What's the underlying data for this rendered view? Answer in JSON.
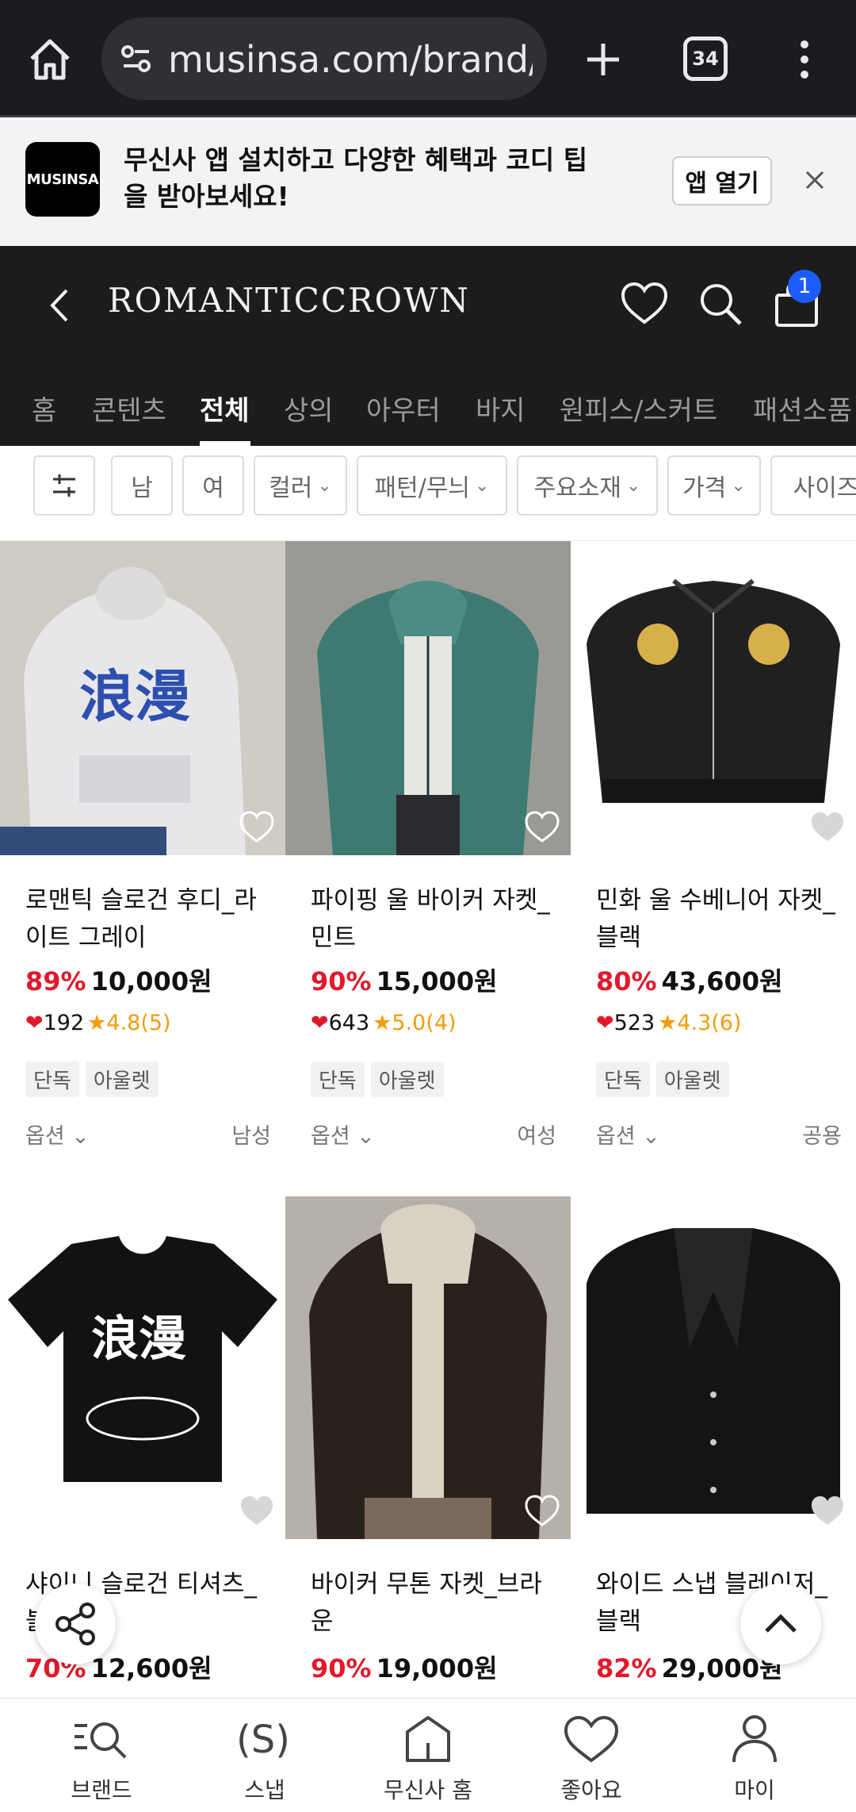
{
  "browser": {
    "url": "musinsa.com/brand/r",
    "tab_count": "34"
  },
  "banner": {
    "logo": "MUSINSA",
    "text": "무신사 앱 설치하고 다양한 혜택과 코디 팁을 받아보세요!",
    "open_label": "앱 열기"
  },
  "brand": {
    "name": "ROMANTICCROWN",
    "cart_count": "1"
  },
  "categories": [
    "홈",
    "콘텐츠",
    "전체",
    "상의",
    "아우터",
    "바지",
    "원피스/스커트",
    "패션소품"
  ],
  "active_category": "전체",
  "filters": {
    "gender_men": "남",
    "gender_women": "여",
    "color": "컬러",
    "pattern": "패턴/무늬",
    "material": "주요소재",
    "price": "가격",
    "size": "사이즈"
  },
  "products": [
    {
      "name": "로맨틱 슬로건 후디_라이트 그레이",
      "discount": "89%",
      "price": "10,000원",
      "likes": "192",
      "rating": "4.8(5)",
      "tags": [
        "단독",
        "아울렛"
      ],
      "option": "옵션",
      "gender": "남성"
    },
    {
      "name": "파이핑 울 바이커 자켓_민트",
      "discount": "90%",
      "price": "15,000원",
      "likes": "643",
      "rating": "5.0(4)",
      "tags": [
        "단독",
        "아울렛"
      ],
      "option": "옵션",
      "gender": "여성"
    },
    {
      "name": "민화 울 수베니어 자켓_블랙",
      "discount": "80%",
      "price": "43,600원",
      "likes": "523",
      "rating": "4.3(6)",
      "tags": [
        "단독",
        "아울렛"
      ],
      "option": "옵션",
      "gender": "공용"
    },
    {
      "name": "샤이니 슬로건 티셔츠_블",
      "discount": "70%",
      "price": "12,600원"
    },
    {
      "name": "바이커 무톤 자켓_브라운",
      "discount": "90%",
      "price": "19,000원"
    },
    {
      "name": "와이드 스냅 블레이저_블랙",
      "discount": "82%",
      "price": "29,000원"
    }
  ],
  "nav": [
    {
      "label": "브랜드",
      "icon": "brand-search-icon"
    },
    {
      "label": "스냅",
      "icon": "snap-icon"
    },
    {
      "label": "무신사 홈",
      "icon": "home-icon"
    },
    {
      "label": "좋아요",
      "icon": "heart-icon"
    },
    {
      "label": "마이",
      "icon": "person-icon"
    }
  ],
  "colors": {
    "discount": "#e0192b",
    "rating": "#f29c0c",
    "badge": "#1c5cff",
    "header": "#1c1c1c"
  }
}
